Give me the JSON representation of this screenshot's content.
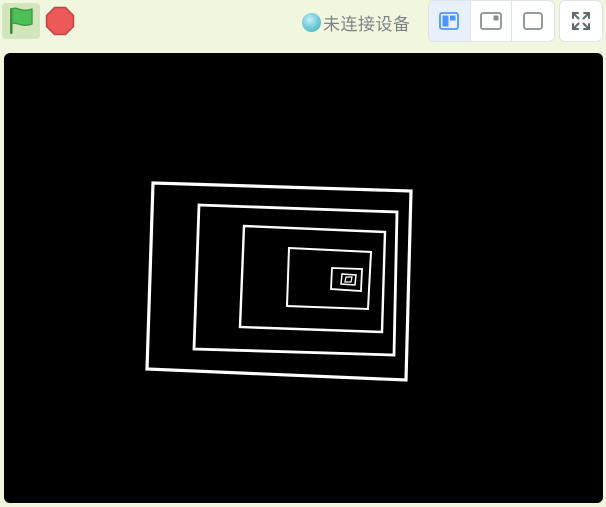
{
  "toolbar": {
    "green_flag_icon": "green-flag-icon",
    "stop_icon": "stop-sign-icon",
    "device_status_label": "未连接设备",
    "device_status_icon": "status-dot-icon",
    "layout_buttons": [
      {
        "icon": "small-stage-layout-icon",
        "active": true
      },
      {
        "icon": "large-stage-layout-icon",
        "active": false
      },
      {
        "icon": "full-stage-layout-icon",
        "active": false
      }
    ],
    "fullscreen_icon": "fullscreen-icon"
  },
  "colors": {
    "background": "#f0f7de",
    "flag_green": "#4cbf56",
    "stop_red": "#ec5959",
    "stage_background": "#000000",
    "drawing_stroke": "#ffffff",
    "layout_active_blue": "#4c97ff"
  },
  "stage": {
    "content": "nested-rotated-squares-drawing"
  }
}
